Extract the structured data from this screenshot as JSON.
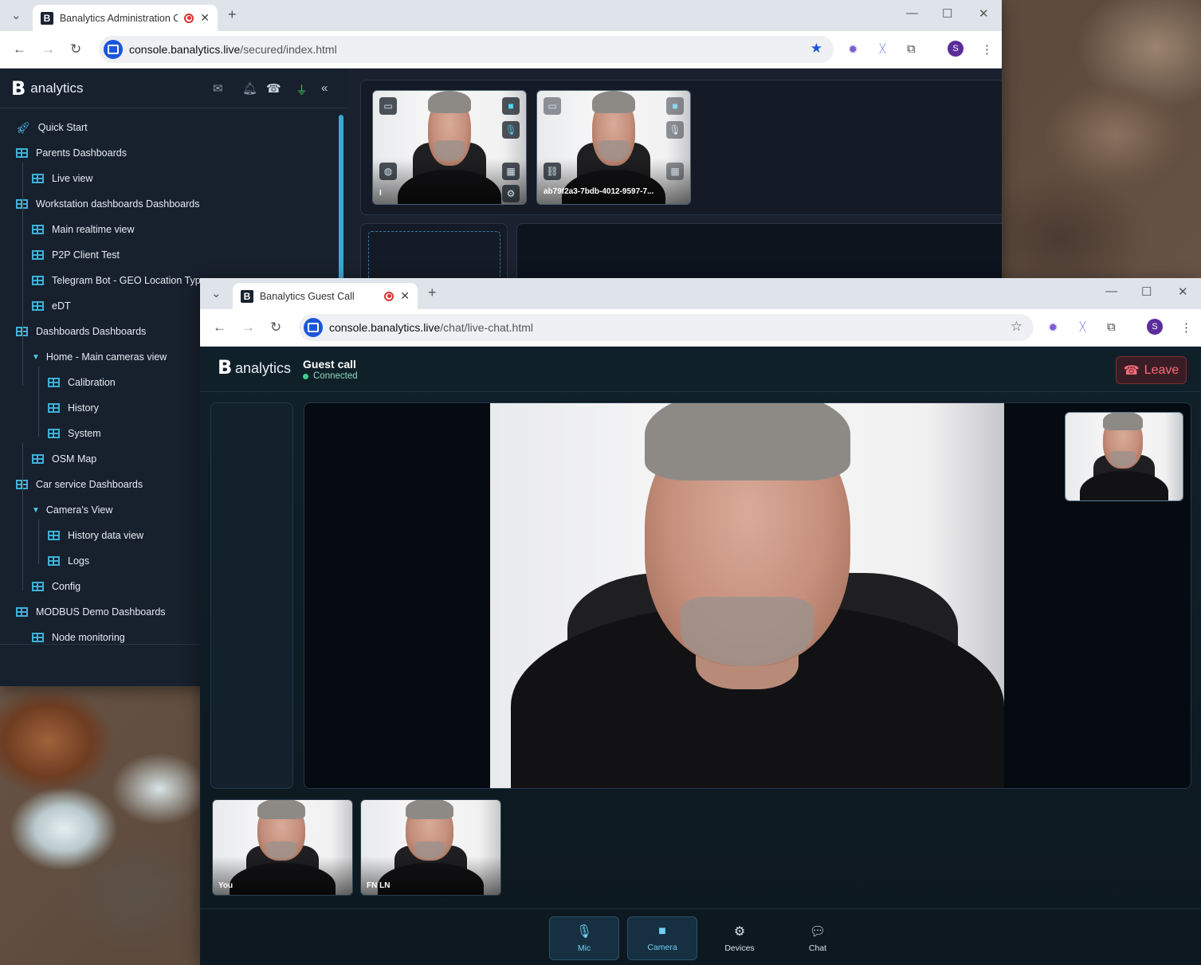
{
  "win1": {
    "tab_title": "Banalytics Administration C",
    "new_tab": "+",
    "url_host": "console.banalytics.live",
    "url_path": "/secured/index.html",
    "profile_initial": "S"
  },
  "admin": {
    "brand_letter": "B",
    "brand_text": "analytics",
    "menu": [
      {
        "label": "Quick Start",
        "indent": 0,
        "icon": "rocket-icon"
      },
      {
        "label": "Parents Dashboards",
        "indent": 0,
        "icon": "grid-icon"
      },
      {
        "label": "Live view",
        "indent": 1,
        "icon": "grid-icon"
      },
      {
        "label": "Workstation dashboards Dashboards",
        "indent": 0,
        "icon": "grid-icon"
      },
      {
        "label": "Main realtime view",
        "indent": 1,
        "icon": "grid-icon"
      },
      {
        "label": "P2P Client Test",
        "indent": 1,
        "icon": "grid-icon"
      },
      {
        "label": "Telegram Bot - GEO Location Type",
        "indent": 1,
        "icon": "grid-icon"
      },
      {
        "label": "eDT",
        "indent": 1,
        "icon": "grid-icon"
      },
      {
        "label": "Dashboards Dashboards",
        "indent": 0,
        "icon": "grid-icon"
      },
      {
        "label": "Home - Main cameras view",
        "indent": 1,
        "icon": "caret-down-icon"
      },
      {
        "label": "Calibration",
        "indent": 2,
        "icon": "grid-icon"
      },
      {
        "label": "History",
        "indent": 2,
        "icon": "grid-icon"
      },
      {
        "label": "System",
        "indent": 2,
        "icon": "grid-icon"
      },
      {
        "label": "OSM Map",
        "indent": 1,
        "icon": "grid-icon"
      },
      {
        "label": "Car service Dashboards",
        "indent": 0,
        "icon": "grid-icon"
      },
      {
        "label": "Camera's View",
        "indent": 1,
        "icon": "caret-down-icon"
      },
      {
        "label": "History data view",
        "indent": 2,
        "icon": "grid-icon"
      },
      {
        "label": "Logs",
        "indent": 2,
        "icon": "grid-icon"
      },
      {
        "label": "Config",
        "indent": 1,
        "icon": "grid-icon"
      },
      {
        "label": "MODBUS Demo Dashboards",
        "indent": 0,
        "icon": "grid-icon"
      },
      {
        "label": "Node monitoring",
        "indent": 1,
        "icon": "grid-icon"
      }
    ],
    "cam1_label": "I",
    "cam2_label": "ab79f2a3-7bdb-4012-9597-7...",
    "colors": {
      "accent": "#3fb0d6",
      "plug": "#3ecf5a"
    }
  },
  "win2": {
    "tab_title": "Banalytics Guest Call",
    "new_tab": "+",
    "url_host": "console.banalytics.live",
    "url_path": "/chat/live-chat.html",
    "profile_initial": "S"
  },
  "guest": {
    "brand_letter": "B",
    "brand_text": "analytics",
    "title": "Guest call",
    "status": "Connected",
    "leave_label": "Leave",
    "thumbs": [
      "You",
      "FN LN"
    ],
    "controls": [
      {
        "label": "Mic",
        "icon": "mic-icon",
        "active": true
      },
      {
        "label": "Camera",
        "icon": "camera-icon",
        "active": true
      },
      {
        "label": "Devices",
        "icon": "gear-icon",
        "active": false
      },
      {
        "label": "Chat",
        "icon": "chat-icon",
        "active": false
      }
    ],
    "colors": {
      "leave": "#ff6b7b",
      "connected": "#3ecf8e"
    }
  }
}
